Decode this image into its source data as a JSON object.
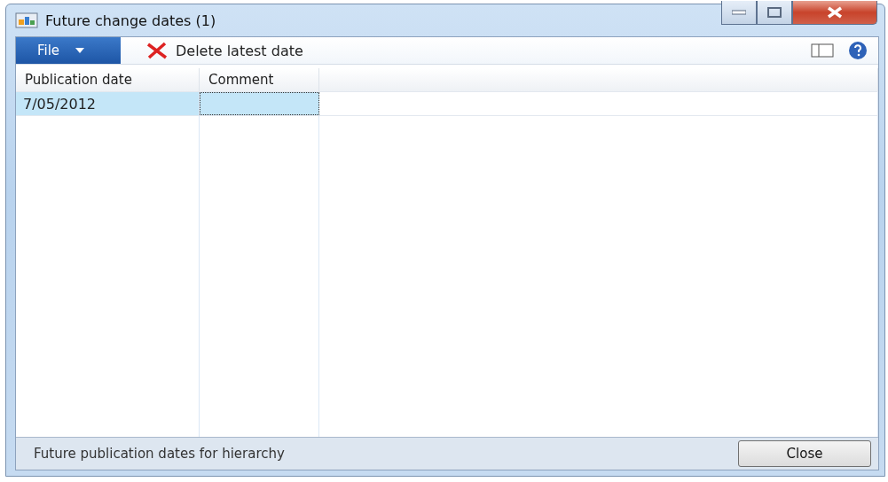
{
  "window": {
    "title": "Future change dates (1)"
  },
  "toolbar": {
    "file_menu": "File",
    "actions": [
      {
        "label": "Delete latest date"
      }
    ]
  },
  "table": {
    "columns": [
      "Publication date",
      "Comment"
    ],
    "rows": [
      {
        "cells": [
          {
            "text": "7/05/2012",
            "focused": false
          },
          {
            "focused": true
          }
        ],
        "selected": true
      }
    ]
  },
  "status_bar": {
    "text": "Future publication dates for hierarchy"
  },
  "buttons": [
    {
      "label": "Close"
    }
  ]
}
